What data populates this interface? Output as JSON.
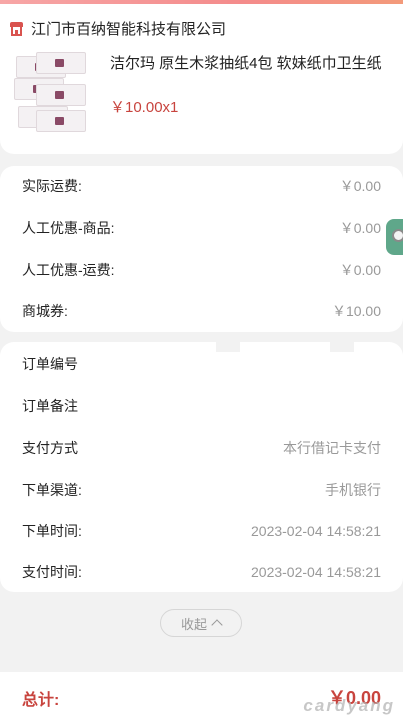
{
  "store": {
    "name": "江门市百纳智能科技有限公司",
    "icon": "store-icon"
  },
  "product": {
    "title": "洁尔玛 原生木浆抽纸4包 软妹纸巾卫生纸",
    "price": "￥10.00x1"
  },
  "fees": [
    {
      "label": "实际运费:",
      "value": "￥0.00"
    },
    {
      "label": "人工优惠-商品:",
      "value": "￥0.00"
    },
    {
      "label": "人工优惠-运费:",
      "value": "￥0.00"
    },
    {
      "label": "商城券:",
      "value": "￥10.00"
    }
  ],
  "order_info": [
    {
      "label": "订单编号",
      "value": ""
    },
    {
      "label": "订单备注",
      "value": ""
    },
    {
      "label": "支付方式",
      "value": "本行借记卡支付"
    },
    {
      "label": "下单渠道:",
      "value": "手机银行"
    },
    {
      "label": "下单时间:",
      "value": "2023-02-04 14:58:21"
    },
    {
      "label": "支付时间:",
      "value": "2023-02-04 14:58:21"
    }
  ],
  "collapse_label": "收起",
  "total": {
    "label": "总计:",
    "value": "￥0.00"
  },
  "watermark": "cardyang",
  "colors": {
    "accent": "#c8443e",
    "muted": "#999999",
    "background": "#f2f2f2"
  }
}
